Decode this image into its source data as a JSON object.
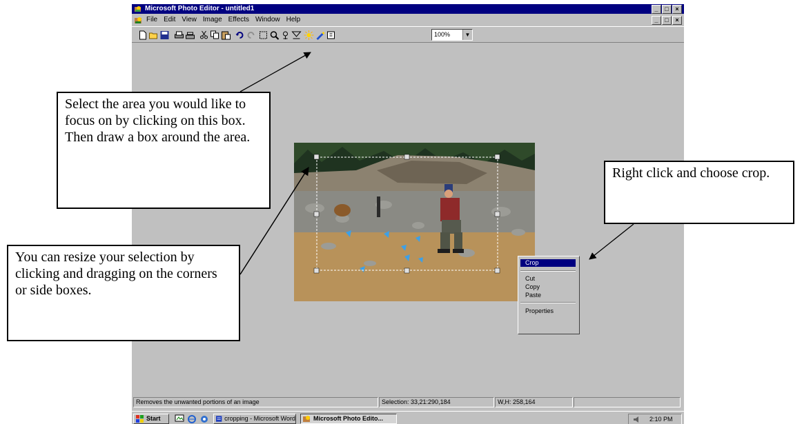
{
  "window": {
    "title": "Microsoft Photo Editor - untitled1",
    "buttons": [
      "_",
      "□",
      "×"
    ]
  },
  "menu": {
    "items": [
      "File",
      "Edit",
      "View",
      "Image",
      "Effects",
      "Window",
      "Help"
    ]
  },
  "toolbar": {
    "icons": [
      "new-icon",
      "open-icon",
      "save-icon",
      "print-icon",
      "scan-icon",
      "cut-icon",
      "copy-icon",
      "paste-icon",
      "undo-icon",
      "redo-icon",
      "select-icon",
      "zoom-icon",
      "smudge-icon",
      "sharpen-icon",
      "balance-icon",
      "eraser-icon",
      "help-icon"
    ],
    "zoom_value": "100%"
  },
  "context_menu": {
    "items": [
      "Crop",
      "Cut",
      "Copy",
      "Paste",
      "Properties"
    ],
    "selected": "Crop"
  },
  "status": {
    "hint": "Removes the unwanted portions of an image",
    "selection": "Selection: 33,21:290,184",
    "size": "W,H: 258,164"
  },
  "taskbar": {
    "start": "Start",
    "task1": "cropping - Microsoft Word",
    "task2": "Microsoft Photo Edito...",
    "clock": "2:10 PM"
  },
  "callouts": {
    "select_box": "Select the area you would like to focus on by clicking on this box. Then draw a box around the area.",
    "resize": "You can resize your selection by clicking and dragging on the corners or side boxes.",
    "crop": "Right click and choose crop."
  }
}
